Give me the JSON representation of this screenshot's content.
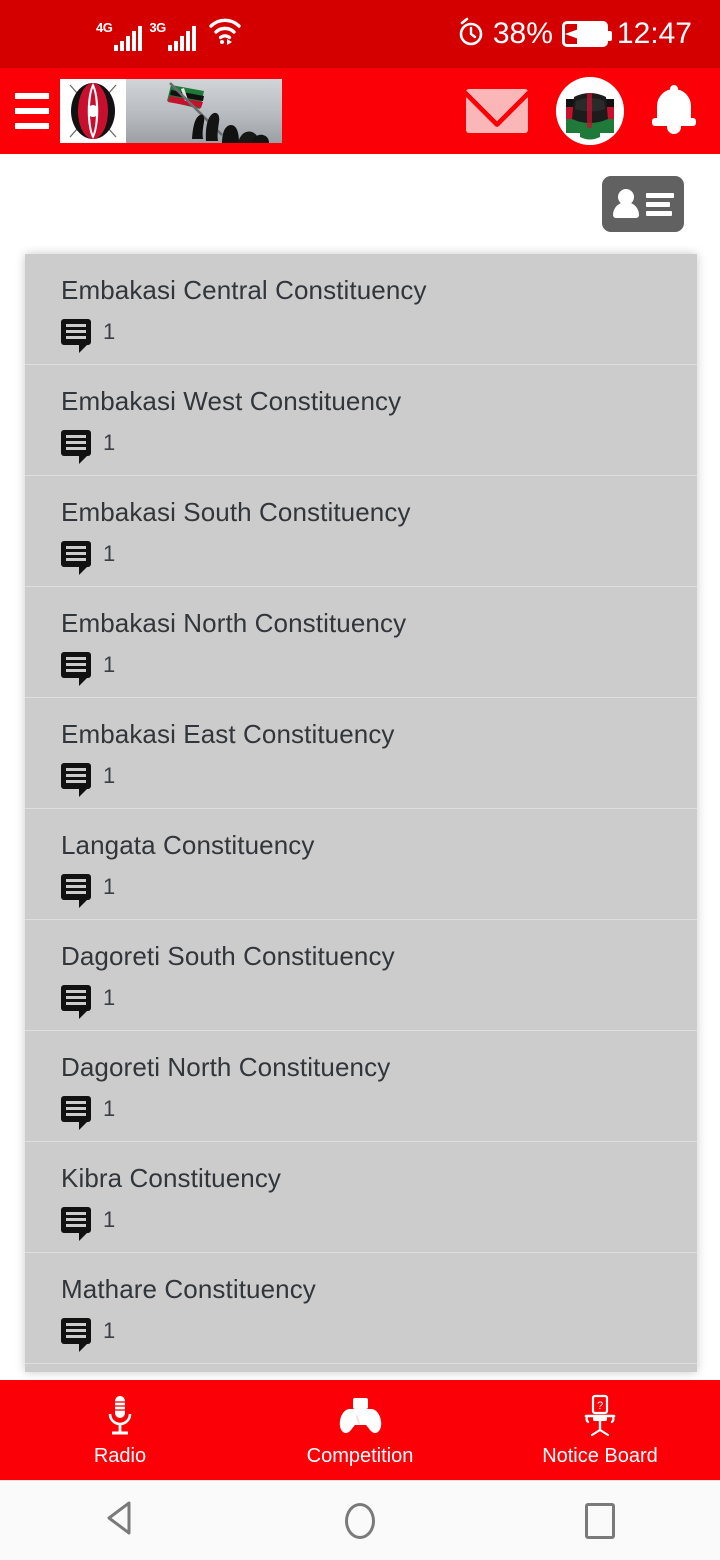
{
  "status_bar": {
    "network_primary": "4G",
    "network_secondary": "3G",
    "wifi_icon": "wifi-icon",
    "alarm_icon": "alarm-icon",
    "battery_percent": "38%",
    "battery_icon": "battery-charging-icon",
    "time": "12:47"
  },
  "app_bar": {
    "menu_icon": "hamburger-menu-icon",
    "logo_alt": "Kenya shield emblem and flag raising photo",
    "mail_icon": "envelope-icon",
    "avatar_icon": "user-avatar-fist-image",
    "bell_icon": "notification-bell-icon"
  },
  "content": {
    "contact_button_icon": "contact-card-icon",
    "list": [
      {
        "title": "Embakasi Central Constituency",
        "comment_icon": "comment-bubble-icon",
        "count": "1"
      },
      {
        "title": "Embakasi West Constituency",
        "comment_icon": "comment-bubble-icon",
        "count": "1"
      },
      {
        "title": "Embakasi South Constituency",
        "comment_icon": "comment-bubble-icon",
        "count": "1"
      },
      {
        "title": "Embakasi North Constituency",
        "comment_icon": "comment-bubble-icon",
        "count": "1"
      },
      {
        "title": "Embakasi East Constituency",
        "comment_icon": "comment-bubble-icon",
        "count": "1"
      },
      {
        "title": "Langata Constituency",
        "comment_icon": "comment-bubble-icon",
        "count": "1"
      },
      {
        "title": "Dagoreti South Constituency",
        "comment_icon": "comment-bubble-icon",
        "count": "1"
      },
      {
        "title": "Dagoreti North Constituency",
        "comment_icon": "comment-bubble-icon",
        "count": "1"
      },
      {
        "title": "Kibra Constituency",
        "comment_icon": "comment-bubble-icon",
        "count": "1"
      },
      {
        "title": "Mathare Constituency",
        "comment_icon": "comment-bubble-icon",
        "count": "1"
      }
    ]
  },
  "tab_bar": {
    "tabs": [
      {
        "label": "Radio",
        "icon": "microphone-icon"
      },
      {
        "label": "Competition",
        "icon": "gamepad-icon"
      },
      {
        "label": "Notice Board",
        "icon": "office-chair-question-icon"
      }
    ]
  },
  "nav_bar": {
    "back_icon": "back-triangle-icon",
    "home_icon": "home-circle-icon",
    "recents_icon": "recents-square-icon"
  },
  "colors": {
    "status_bar_red": "#d40000",
    "brand_red": "#fb0007",
    "list_gray": "#cccccc",
    "contact_button_gray": "#616161",
    "text_dark": "#32363a"
  }
}
